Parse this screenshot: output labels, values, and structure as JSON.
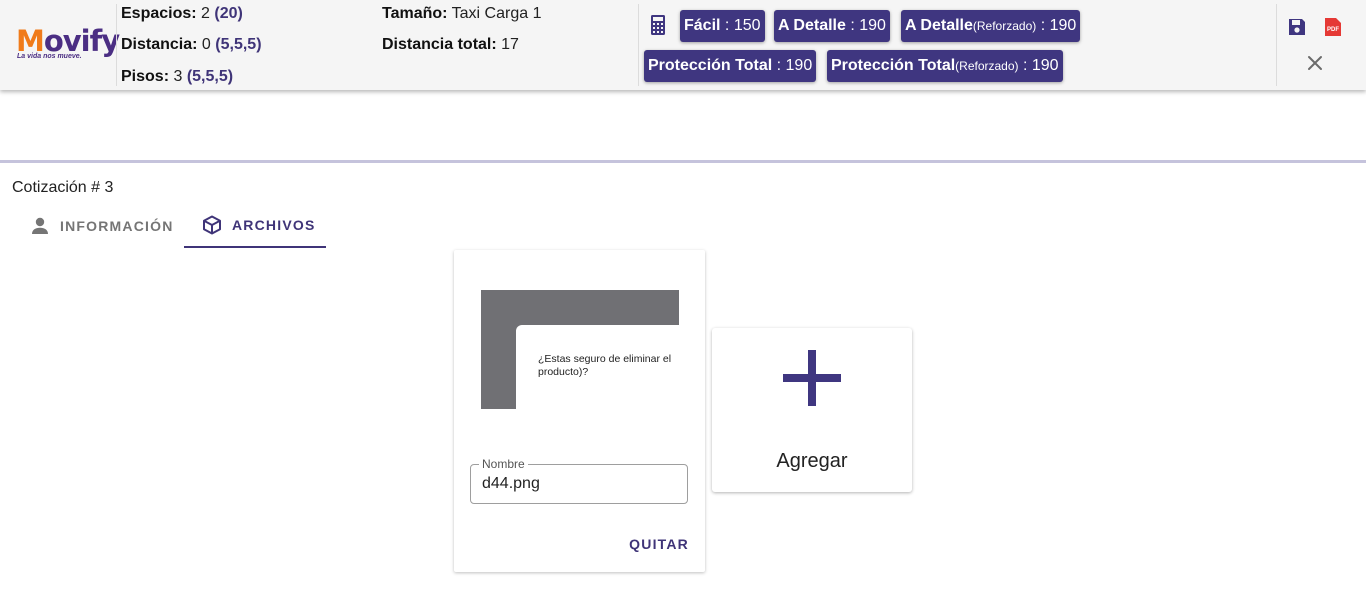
{
  "brand": {
    "name_m": "M",
    "name_rest": "ovify",
    "tagline": "La vida nos mueve."
  },
  "summary": {
    "espacios_label": "Espacios:",
    "espacios_value": "2",
    "espacios_extra": "(20)",
    "distancia_label": "Distancia:",
    "distancia_value": "0",
    "distancia_extra": "(5,5,5)",
    "pisos_label": "Pisos:",
    "pisos_value": "3",
    "pisos_extra": "(5,5,5)",
    "tamano_label": "Tamaño:",
    "tamano_value": "Taxi Carga 1",
    "distancia_total_label": "Distancia total:",
    "distancia_total_value": "17"
  },
  "prices": {
    "facil": {
      "name": "Fácil",
      "value": ": 150"
    },
    "detalle": {
      "name": "A Detalle",
      "value": ": 190"
    },
    "detalle_ref": {
      "name": "A Detalle",
      "suffix": "(Reforzado)",
      "value": ": 190"
    },
    "proteccion": {
      "name": "Protección Total",
      "value": ": 190"
    },
    "proteccion_ref": {
      "name": "Protección Total",
      "suffix": "(Reforzado)",
      "value": ": 190"
    }
  },
  "actions": {
    "pdf_label": "PDF"
  },
  "quote": {
    "title": "Cotización # 3"
  },
  "tabs": [
    {
      "label": "INFORMACIÓN"
    },
    {
      "label": "ARCHIVOS"
    }
  ],
  "file": {
    "preview_text": "¿Estas seguro de eliminar el producto)?",
    "name_label": "Nombre",
    "name_value": "d44.png",
    "remove_label": "QUITAR"
  },
  "add": {
    "label": "Agregar"
  },
  "colors": {
    "primary": "#3f3680",
    "brand_orange": "#f07b1a",
    "brand_purple": "#4b2e83"
  },
  "icons": [
    "calculator-icon",
    "save-icon",
    "pdf-icon",
    "close-icon",
    "person-icon",
    "package-icon",
    "plus-icon"
  ]
}
